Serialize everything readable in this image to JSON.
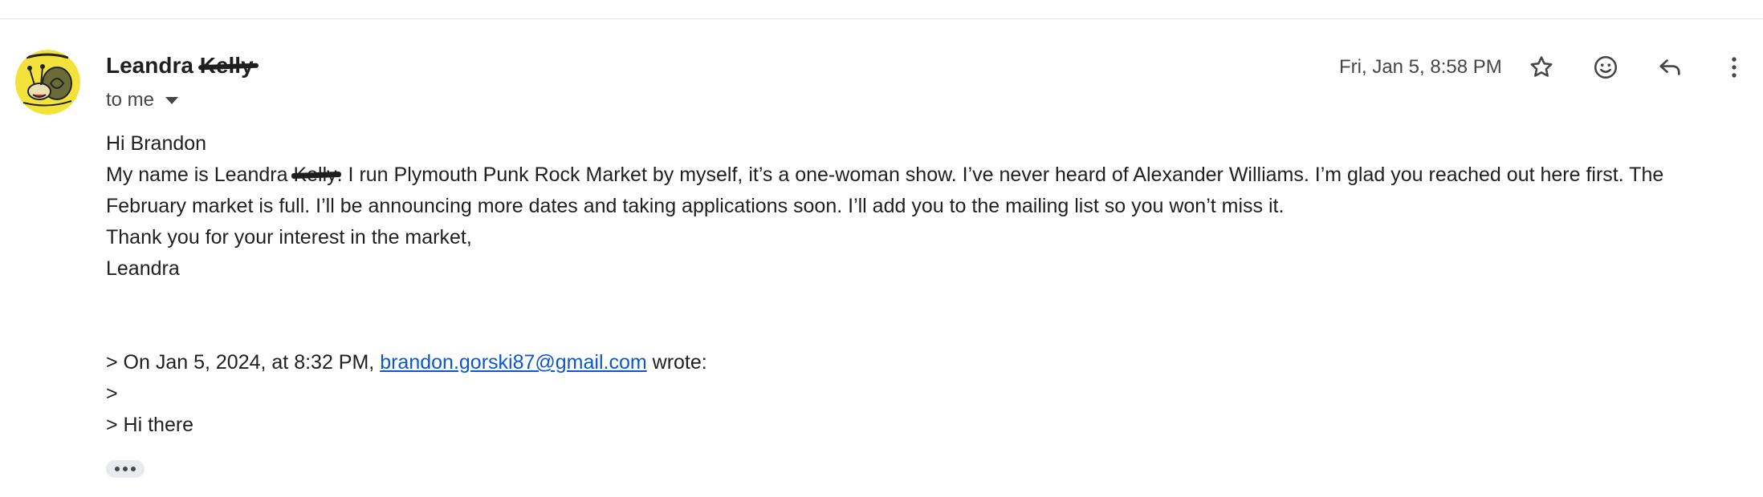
{
  "sender": {
    "first_name": "Leandra",
    "last_name_redacted": "Kelly"
  },
  "recipient_label": "to me",
  "timestamp": "Fri, Jan 5, 8:58 PM",
  "toolbar": {
    "star_icon": "star-icon",
    "emoji_icon": "emoji-react-icon",
    "reply_icon": "reply-icon",
    "more_icon": "more-vert-icon"
  },
  "body": {
    "greeting": "Hi Brandon",
    "para1_before": "My name is Leandra",
    "para1_redacted": "Kelly",
    "para1_after": ". I run Plymouth Punk Rock Market by myself, it’s a one-woman show. I’ve never heard of Alexander Williams. I’m glad you reached out here first. The February market is full. I’ll be announcing more dates and taking applications soon. I’ll add you to the mailing list so you won’t miss it.",
    "thanks": "Thank you for your interest in the market,",
    "signature": "Leandra"
  },
  "quote": {
    "line1_prefix": "> On Jan 5, 2024, at 8:32 PM,",
    "email": "brandon.gorski87@gmail.com",
    "line1_suffix": "wrote:",
    "line2": ">",
    "line3": "> Hi there"
  },
  "colors": {
    "link": "#0b57d0",
    "avatar_bg": "#f2e23a"
  }
}
